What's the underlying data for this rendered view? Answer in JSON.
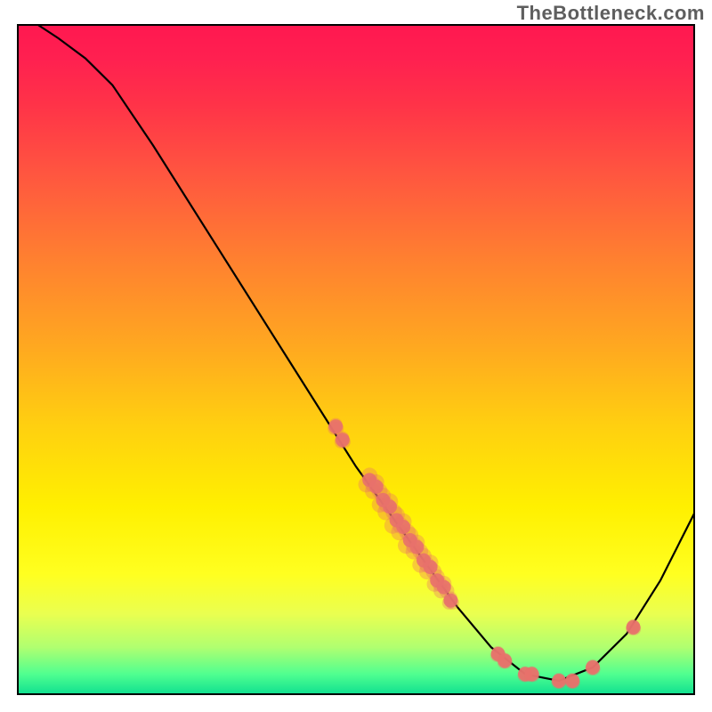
{
  "watermark": "TheBottleneck.com",
  "chart_data": {
    "type": "line",
    "title": "",
    "xlabel": "",
    "ylabel": "",
    "xlim": [
      0,
      100
    ],
    "ylim": [
      0,
      100
    ],
    "curve": [
      {
        "x": 3,
        "y": 100
      },
      {
        "x": 6,
        "y": 98
      },
      {
        "x": 10,
        "y": 95
      },
      {
        "x": 14,
        "y": 91
      },
      {
        "x": 20,
        "y": 82
      },
      {
        "x": 30,
        "y": 66
      },
      {
        "x": 40,
        "y": 50
      },
      {
        "x": 50,
        "y": 34
      },
      {
        "x": 55,
        "y": 27
      },
      {
        "x": 60,
        "y": 20
      },
      {
        "x": 65,
        "y": 13
      },
      {
        "x": 70,
        "y": 7
      },
      {
        "x": 75,
        "y": 3
      },
      {
        "x": 80,
        "y": 2
      },
      {
        "x": 85,
        "y": 4
      },
      {
        "x": 90,
        "y": 9
      },
      {
        "x": 95,
        "y": 17
      },
      {
        "x": 100,
        "y": 27
      }
    ],
    "dots": [
      {
        "x": 47,
        "y": 40,
        "spread": 0.5
      },
      {
        "x": 48,
        "y": 38,
        "spread": 0.5
      },
      {
        "x": 52,
        "y": 32,
        "spread": 1.2
      },
      {
        "x": 53,
        "y": 31,
        "spread": 1.2
      },
      {
        "x": 54,
        "y": 29,
        "spread": 1.2
      },
      {
        "x": 55,
        "y": 28,
        "spread": 1.4
      },
      {
        "x": 56,
        "y": 26,
        "spread": 1.4
      },
      {
        "x": 57,
        "y": 25,
        "spread": 1.4
      },
      {
        "x": 58,
        "y": 23,
        "spread": 1.4
      },
      {
        "x": 59,
        "y": 22,
        "spread": 1.2
      },
      {
        "x": 60,
        "y": 20,
        "spread": 1.2
      },
      {
        "x": 61,
        "y": 19,
        "spread": 1.2
      },
      {
        "x": 62,
        "y": 17,
        "spread": 1.0
      },
      {
        "x": 63,
        "y": 16,
        "spread": 1.0
      },
      {
        "x": 64,
        "y": 14,
        "spread": 0.6
      },
      {
        "x": 71,
        "y": 6,
        "spread": 0.4
      },
      {
        "x": 72,
        "y": 5,
        "spread": 0.4
      },
      {
        "x": 75,
        "y": 3,
        "spread": 0.4
      },
      {
        "x": 76,
        "y": 3,
        "spread": 0.4
      },
      {
        "x": 80,
        "y": 2,
        "spread": 0.4
      },
      {
        "x": 82,
        "y": 2,
        "spread": 0.4
      },
      {
        "x": 85,
        "y": 4,
        "spread": 0.4
      },
      {
        "x": 91,
        "y": 10,
        "spread": 0.4
      }
    ],
    "gradient_stops": [
      {
        "offset": 0.0,
        "color": "#ff1850"
      },
      {
        "offset": 0.05,
        "color": "#ff2050"
      },
      {
        "offset": 0.12,
        "color": "#ff3348"
      },
      {
        "offset": 0.22,
        "color": "#ff5540"
      },
      {
        "offset": 0.35,
        "color": "#ff8030"
      },
      {
        "offset": 0.48,
        "color": "#ffa820"
      },
      {
        "offset": 0.6,
        "color": "#ffd010"
      },
      {
        "offset": 0.72,
        "color": "#fff000"
      },
      {
        "offset": 0.82,
        "color": "#ffff20"
      },
      {
        "offset": 0.88,
        "color": "#eaff50"
      },
      {
        "offset": 0.93,
        "color": "#b0ff70"
      },
      {
        "offset": 0.97,
        "color": "#50ff90"
      },
      {
        "offset": 1.0,
        "color": "#10e090"
      }
    ],
    "dot_color": "#e8716b",
    "line_color": "#000000",
    "line_width": 2.2
  }
}
